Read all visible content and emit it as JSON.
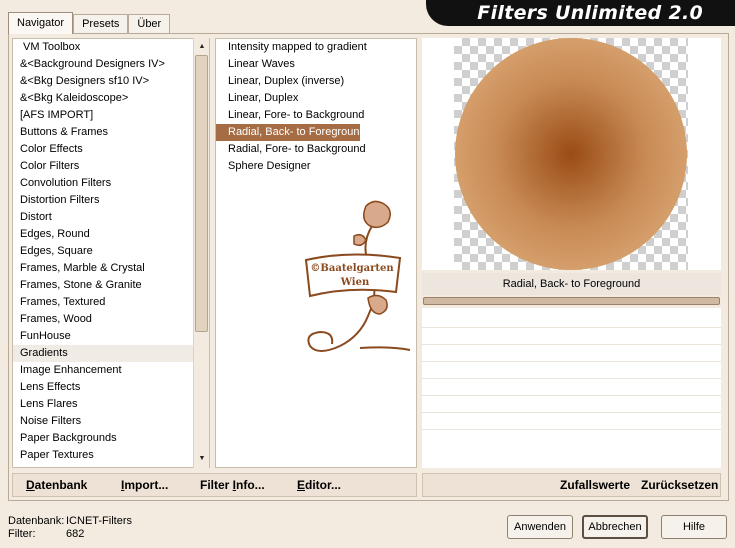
{
  "title": "Filters Unlimited 2.0",
  "tabs": [
    "Navigator",
    "Presets",
    "Über"
  ],
  "categories": [
    "VM Toolbox",
    "&<Background Designers IV>",
    "&<Bkg Designers sf10 IV>",
    "&<Bkg Kaleidoscope>",
    "[AFS IMPORT]",
    "Buttons & Frames",
    "Color Effects",
    "Color Filters",
    "Convolution Filters",
    "Distortion Filters",
    "Distort",
    "Edges, Round",
    "Edges, Square",
    "Frames, Marble & Crystal",
    "Frames, Stone & Granite",
    "Frames, Textured",
    "Frames, Wood",
    "FunHouse",
    "Gradients",
    "Image Enhancement",
    "Lens Effects",
    "Lens Flares",
    "Noise Filters",
    "Paper Backgrounds",
    "Paper Textures"
  ],
  "selected_category": "Gradients",
  "filters": [
    "Intensity mapped to gradient",
    "Linear Waves",
    "Linear, Duplex (inverse)",
    "Linear, Duplex",
    "Linear, Fore- to Background",
    "Radial, Back- to Foreground",
    "Radial, Fore- to Background",
    "Sphere Designer"
  ],
  "selected_filter": "Radial, Back- to Foreground",
  "watermark": {
    "line1": "©Baatelgarten",
    "line2": "Wien"
  },
  "preview_label": "Radial, Back- to Foreground",
  "left_buttons": [
    {
      "accel": "D",
      "rest": "atenbank"
    },
    {
      "accel": "I",
      "rest": "mport..."
    },
    {
      "accel": "",
      "pre": "Filter ",
      "accel2": "I",
      "rest": "nfo..."
    },
    {
      "accel": "E",
      "rest": "ditor..."
    }
  ],
  "right_buttons": [
    "Zufallswerte",
    "Zurücksetzen"
  ],
  "status": {
    "db_label": "Datenbank:",
    "db_value": "ICNET-Filters",
    "filter_label": "Filter:",
    "filter_value": "682"
  },
  "buttons": {
    "apply": "Anwenden",
    "cancel": "Abbrechen",
    "help": "Hilfe"
  },
  "colors": {
    "accent": "#a66d44",
    "background": "#f3ebe0",
    "sphere_center": "#9a4c14",
    "sphere_edge": "#e3b684"
  }
}
